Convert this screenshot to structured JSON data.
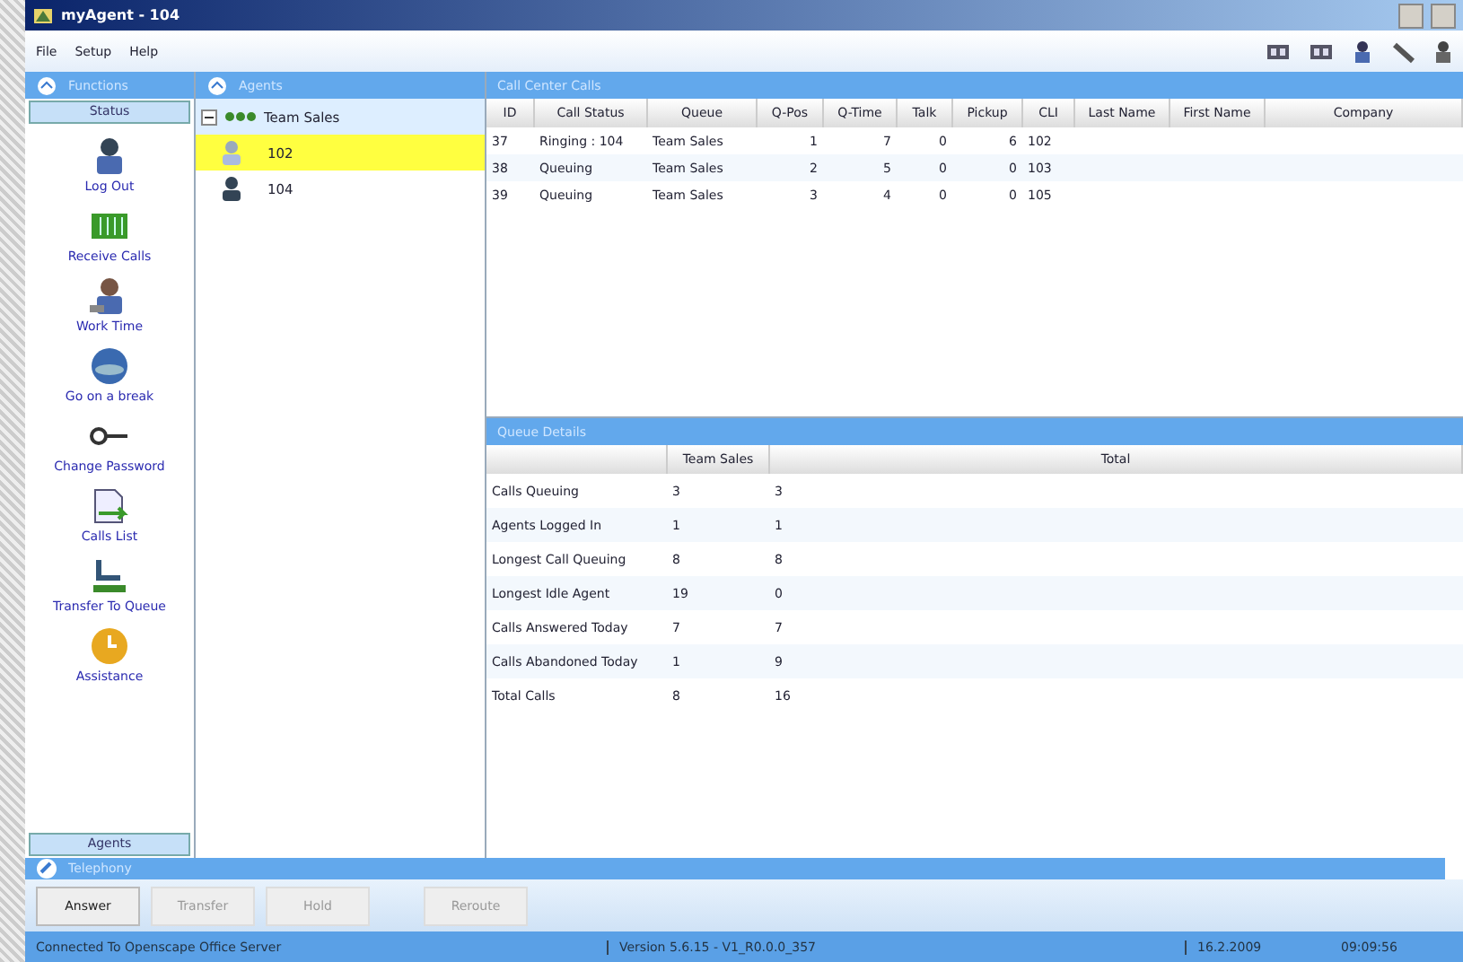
{
  "window": {
    "title": "myAgent - 104"
  },
  "menu": [
    "File",
    "Setup",
    "Help"
  ],
  "functions_panel": {
    "title": "Functions",
    "section": "Status",
    "footer": "Agents",
    "items": [
      {
        "label": "Log Out",
        "kind": "person"
      },
      {
        "label": "Receive Calls",
        "kind": "grid"
      },
      {
        "label": "Work Time",
        "kind": "worker"
      },
      {
        "label": "Go on a break",
        "kind": "globe"
      },
      {
        "label": "Change Password",
        "kind": "key"
      },
      {
        "label": "Calls List",
        "kind": "document"
      },
      {
        "label": "Transfer To Queue",
        "kind": "transfer"
      },
      {
        "label": "Assistance",
        "kind": "clock"
      }
    ]
  },
  "agents_panel": {
    "title": "Agents",
    "groups": [
      {
        "label": "Team Sales",
        "expanded": true,
        "children": [
          {
            "label": "102",
            "selected": true
          },
          {
            "label": "104",
            "selected": false
          }
        ]
      }
    ]
  },
  "calls": {
    "title": "Call Center Calls",
    "columns": [
      "ID",
      "Call Status",
      "Queue",
      "Q-Pos",
      "Q-Time",
      "Talk",
      "Pickup",
      "CLI",
      "Last Name",
      "First Name",
      "Company"
    ],
    "rows": [
      [
        "37",
        "Ringing : 104",
        "Team Sales",
        "1",
        "7",
        "0",
        "6",
        "102",
        "",
        "",
        ""
      ],
      [
        "38",
        "Queuing",
        "Team Sales",
        "2",
        "5",
        "0",
        "0",
        "103",
        "",
        "",
        ""
      ],
      [
        "39",
        "Queuing",
        "Team Sales",
        "3",
        "4",
        "0",
        "0",
        "105",
        "",
        "",
        ""
      ]
    ]
  },
  "queue_details": {
    "title": "Queue Details",
    "columns": [
      "",
      "Team Sales",
      "Total"
    ],
    "rows": [
      [
        "Calls Queuing",
        "3",
        "3"
      ],
      [
        "Agents Logged In",
        "1",
        "1"
      ],
      [
        "Longest Call Queuing",
        "8",
        "8"
      ],
      [
        "Longest Idle Agent",
        "19",
        "0"
      ],
      [
        "Calls Answered Today",
        "7",
        "7"
      ],
      [
        "Calls Abandoned Today",
        "1",
        "9"
      ],
      [
        "Total Calls",
        "8",
        "16"
      ]
    ]
  },
  "telephony": {
    "title": "Telephony",
    "buttons": [
      {
        "label": "Answer",
        "disabled": false
      },
      {
        "label": "Transfer",
        "disabled": true
      },
      {
        "label": "Hold",
        "disabled": true
      },
      {
        "label": "Reroute",
        "disabled": true
      }
    ]
  },
  "status_bar": {
    "connection": "Connected To Openscape Office Server",
    "version": "Version 5.6.15 - V1_R0.0.0_357",
    "date": "16.2.2009",
    "time": "09:09:56"
  }
}
